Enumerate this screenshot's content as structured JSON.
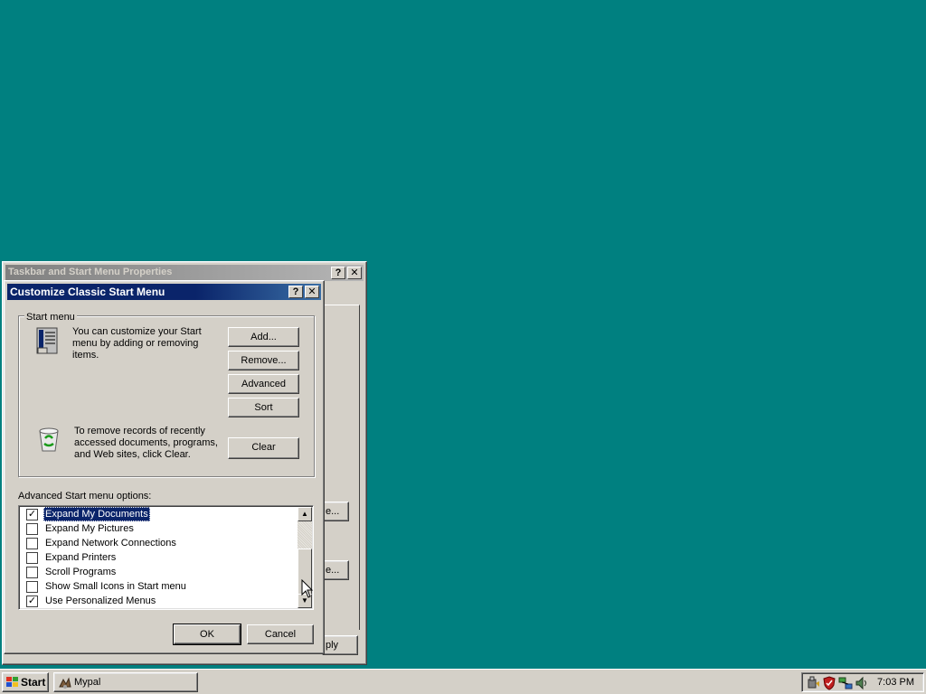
{
  "back_window": {
    "title": "Taskbar and Start Menu Properties",
    "help_glyph": "?",
    "close_glyph": "✕",
    "fragment_1": "e...",
    "fragment_2": "e...",
    "fragment_apply": "ply"
  },
  "dialog": {
    "title": "Customize Classic Start Menu",
    "help_glyph": "?",
    "close_glyph": "✕",
    "group_label": "Start menu",
    "customize_text": "You can customize your Start menu by adding or removing items.",
    "clear_text": "To remove records of recently accessed documents, programs, and Web sites, click Clear.",
    "buttons": {
      "add": "Add...",
      "remove": "Remove...",
      "advanced": "Advanced",
      "sort": "Sort",
      "clear": "Clear",
      "ok": "OK",
      "cancel": "Cancel"
    },
    "advanced_label": "Advanced Start menu options:",
    "options": [
      {
        "label": "Expand My Documents",
        "checked": true,
        "selected": true
      },
      {
        "label": "Expand My Pictures",
        "checked": false
      },
      {
        "label": "Expand Network Connections",
        "checked": false
      },
      {
        "label": "Expand Printers",
        "checked": false
      },
      {
        "label": "Scroll Programs",
        "checked": false
      },
      {
        "label": "Show Small Icons in Start menu",
        "checked": false
      },
      {
        "label": "Use Personalized Menus",
        "checked": true
      }
    ],
    "check_glyph": "✓",
    "scroll_up_glyph": "▲",
    "scroll_down_glyph": "▼"
  },
  "taskbar": {
    "start_label": "Start",
    "tasks": [
      {
        "label": "Mypal",
        "icon": "mypal-icon"
      }
    ],
    "clock": "7:03 PM",
    "tray_icons": [
      "usb-icon",
      "shield-icon",
      "network-icon",
      "volume-icon"
    ]
  },
  "colors": {
    "desktop": "#008080",
    "active_title": "#0a246a",
    "inactive_title": "#808080",
    "face": "#d4d0c8"
  }
}
